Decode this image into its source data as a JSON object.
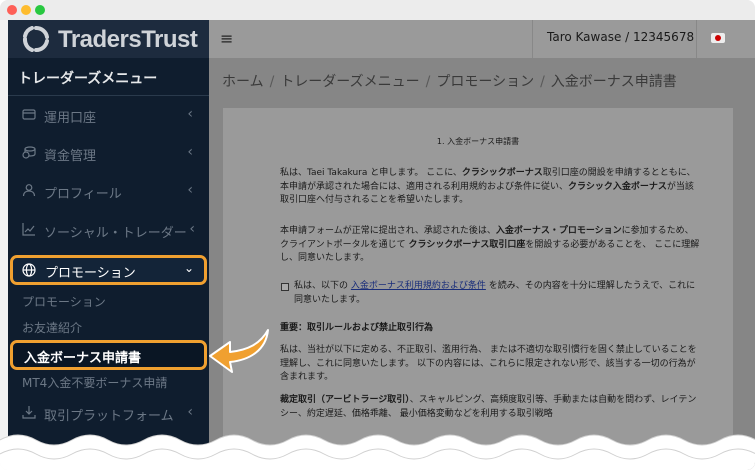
{
  "brand": {
    "name": "TradersTrust"
  },
  "sidebar": {
    "menu_title": "トレーダーズメニュー",
    "items": [
      {
        "label": "運用口座",
        "icon": "wallet-icon"
      },
      {
        "label": "資金管理",
        "icon": "coins-icon"
      },
      {
        "label": "プロフィール",
        "icon": "user-icon"
      },
      {
        "label": "ソーシャル・トレーダー",
        "icon": "chart-line-icon"
      }
    ],
    "promotion": {
      "label": "プロモーション",
      "icon": "globe-icon"
    },
    "sub_items": [
      "プロモーション",
      "お友達紹介",
      "入金ボーナス申請書",
      "MT4入金不要ボーナス申請"
    ],
    "platform": {
      "label": "取引プラットフォーム",
      "icon": "download-icon"
    },
    "chevron_left": "‹",
    "chevron_down": "⌄"
  },
  "topbar": {
    "menu_glyph": "≡",
    "user": "Taro Kawase / 12345678"
  },
  "breadcrumb": [
    "ホーム",
    "トレーダーズメニュー",
    "プロモーション",
    "入金ボーナス申請書"
  ],
  "breadcrumb_sep": "/",
  "form": {
    "title": "1. 入金ボーナス申請書",
    "p1_a": "私は、Taei Takakura と申します。 ここに、",
    "p1_b": "クラシックボーナス",
    "p1_c": "取引口座の開設を申請するとともに、本申請が承認された場合には、適用される利用規約および条件に従い、",
    "p1_d": "クラシック入金ボーナス",
    "p1_e": "が当該取引口座へ付与されることを希望いたします。",
    "p2_a": "本申請フォームが正常に提出され、承認された後は、",
    "p2_b": "入金ボーナス・プロモーション",
    "p2_c": "に参加するため、 クライアントポータルを通じて ",
    "p2_d": "クラシックボーナス取引口座",
    "p2_e": "を開設する必要があることを、 ここに理解し、同意いたします。",
    "c_a": "私は、以下の ",
    "c_link": "入金ボーナス利用規約および条件",
    "c_b": " を読み、その内容を十分に理解したうえで、これに同意いたします。",
    "h1": "重要：取引ルールおよび禁止取引行為",
    "p3": "私は、当社が以下に定める、不正取引、濫用行為、 または不適切な取引慣行を固く禁止していることを理解し、これに同意いたします。 以下の内容には、これらに限定されない形で、該当する一切の行為が含まれます。",
    "p4_a": "裁定取引（アービトラージ取引）",
    "p4_b": "、スキャルピング、高頻度取引等、手動または自動を問わず、レイテンシー、約定遅延、価格乖離、 最小価格変動などを利用する取引戦略"
  },
  "colors": {
    "accent": "#f0a030",
    "sidebar_bg": "#0f1d2e",
    "link": "#1a2e7a"
  }
}
